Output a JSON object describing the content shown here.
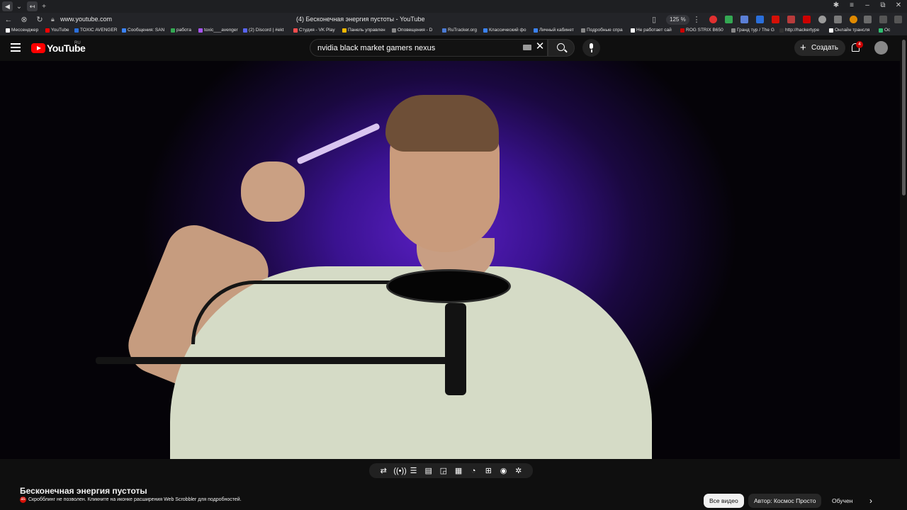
{
  "browser": {
    "url": "www.youtube.com",
    "page_title": "(4) Бесконечная энергия пустоты - YouTube",
    "zoom": "125 %"
  },
  "bookmarks": [
    {
      "label": "Мессенджер",
      "color": "#ffffff"
    },
    {
      "label": "YouTube",
      "color": "#ff0000"
    },
    {
      "label": "TOXIC AVENGER",
      "color": "#2a6fdb"
    },
    {
      "label": "Сообщения: SAN",
      "color": "#3b82f6"
    },
    {
      "label": "работа",
      "color": "#34a853"
    },
    {
      "label": "toxic___avenger",
      "color": "#a855f7"
    },
    {
      "label": "(2) Discord | #ekt",
      "color": "#5865f2"
    },
    {
      "label": "Студия - VK Play",
      "color": "#ff4d4d"
    },
    {
      "label": "Панель управлен",
      "color": "#f5b800"
    },
    {
      "label": "Оповещения - D",
      "color": "#888888"
    },
    {
      "label": "RuTracker.org",
      "color": "#4b7bd4"
    },
    {
      "label": "Классический фо",
      "color": "#3b82f6"
    },
    {
      "label": "Личный кабинет",
      "color": "#3b82f6"
    },
    {
      "label": "Подробные спра",
      "color": "#888888"
    },
    {
      "label": "Не работает сай",
      "color": "#ffffff"
    },
    {
      "label": "ROG STRIX B650",
      "color": "#cc0000"
    },
    {
      "label": "Гранд тур / The G",
      "color": "#888888"
    },
    {
      "label": "http://hackertype",
      "color": "#333333"
    },
    {
      "label": "Онлайн трансля",
      "color": "#ffffff"
    },
    {
      "label": "Ос",
      "color": "#2fbf71"
    }
  ],
  "youtube": {
    "logo_text": "YouTube",
    "region": "RU",
    "search_value": "nvidia black market gamers nexus",
    "create_label": "Создать",
    "notifications": "4"
  },
  "video": {
    "title": "Бесконечная энергия пустоты",
    "scrobble_notice": "Скробблинг не позволен. Кликните на иконке расширения Web Scrobbler для подробностей."
  },
  "chips": [
    {
      "label": "Все видео",
      "active": true
    },
    {
      "label": "Автор: Космос Просто",
      "active": false
    },
    {
      "label": "Обучен",
      "active": false
    }
  ],
  "player_controls": [
    "loop-icon",
    "broadcast-icon",
    "playlist-view-icon",
    "clapperboard-icon",
    "picture-in-picture-icon",
    "subtitles-icon",
    "speed-icon",
    "add-clip-icon",
    "screenshot-icon",
    "settings-icon"
  ]
}
